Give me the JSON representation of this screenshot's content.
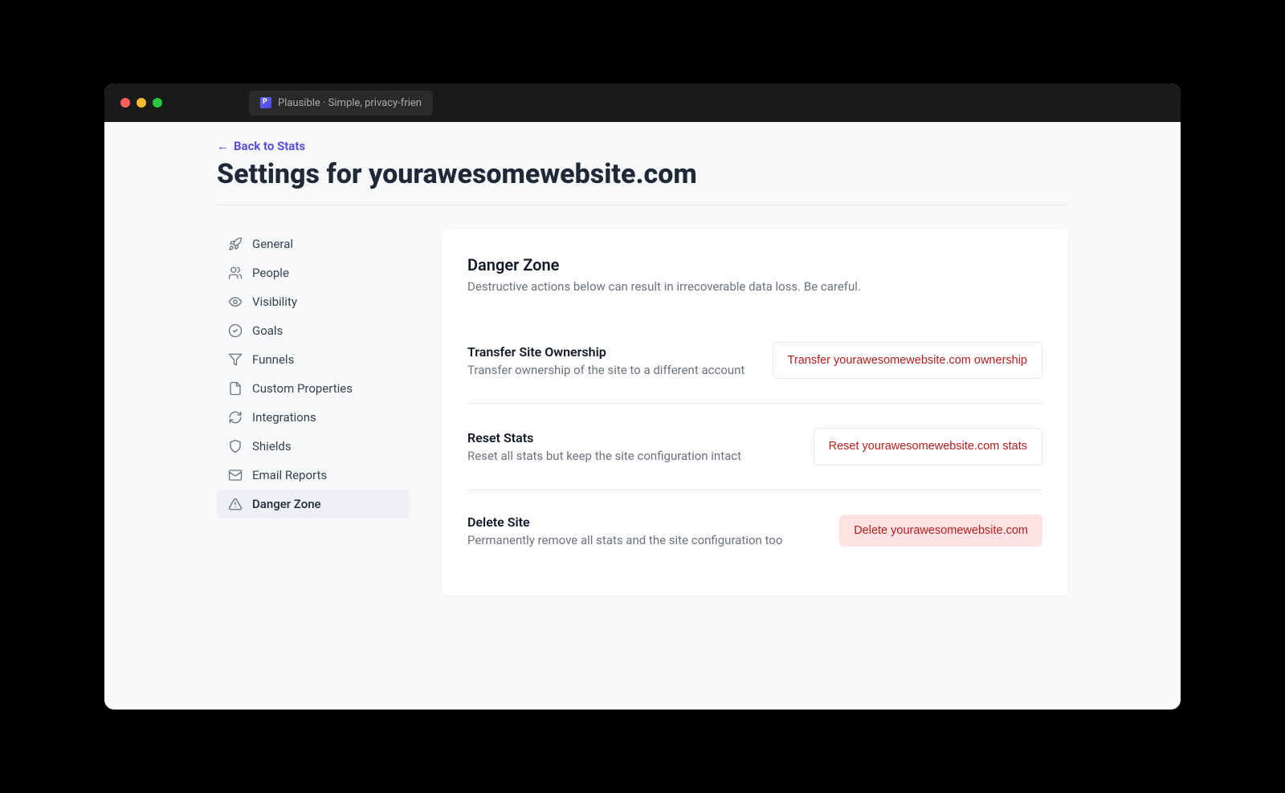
{
  "browser": {
    "tab_title": "Plausible · Simple, privacy-frien"
  },
  "header": {
    "back_link": "Back to Stats",
    "page_title": "Settings for yourawesomewebsite.com"
  },
  "sidebar": {
    "items": [
      {
        "label": "General",
        "icon": "rocket"
      },
      {
        "label": "People",
        "icon": "people"
      },
      {
        "label": "Visibility",
        "icon": "eye"
      },
      {
        "label": "Goals",
        "icon": "check-circle"
      },
      {
        "label": "Funnels",
        "icon": "funnel"
      },
      {
        "label": "Custom Properties",
        "icon": "document"
      },
      {
        "label": "Integrations",
        "icon": "refresh"
      },
      {
        "label": "Shields",
        "icon": "shield"
      },
      {
        "label": "Email Reports",
        "icon": "mail"
      },
      {
        "label": "Danger Zone",
        "icon": "warning",
        "active": true
      }
    ]
  },
  "danger_zone": {
    "title": "Danger Zone",
    "subtitle": "Destructive actions below can result in irrecoverable data loss. Be careful.",
    "rows": [
      {
        "title": "Transfer Site Ownership",
        "desc": "Transfer ownership of the site to a different account",
        "button": "Transfer yourawesomewebsite.com ownership"
      },
      {
        "title": "Reset Stats",
        "desc": "Reset all stats but keep the site configuration intact",
        "button": "Reset yourawesomewebsite.com stats"
      },
      {
        "title": "Delete Site",
        "desc": "Permanently remove all stats and the site configuration too",
        "button": "Delete yourawesomewebsite.com"
      }
    ]
  }
}
